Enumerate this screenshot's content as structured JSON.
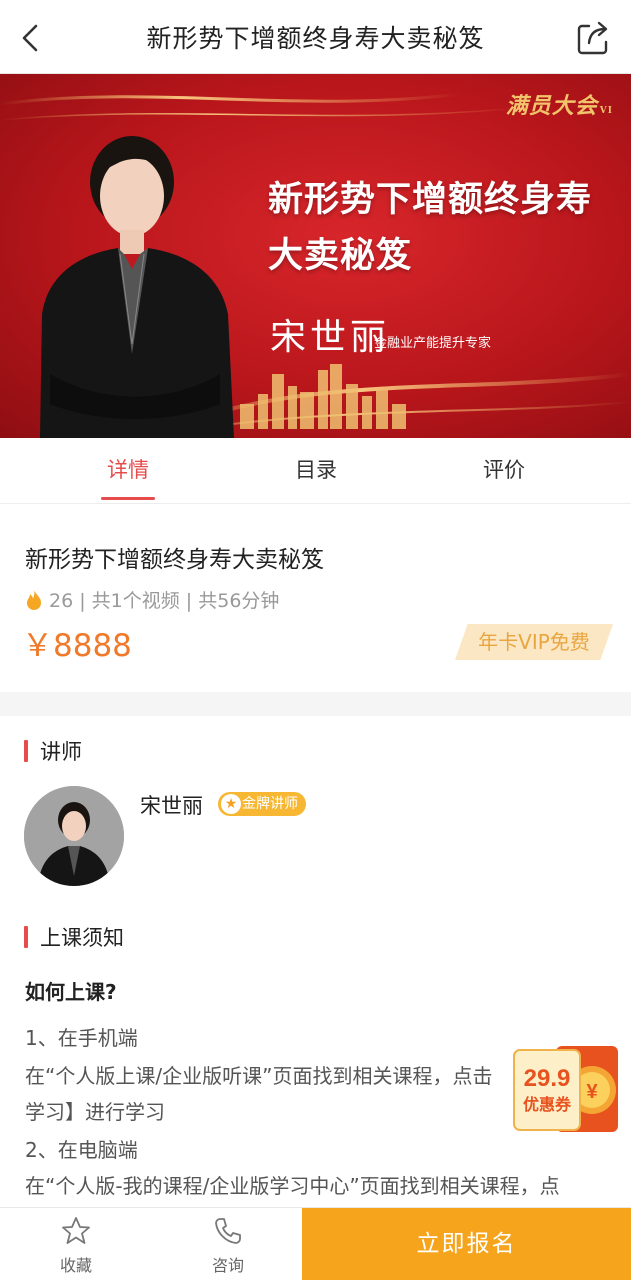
{
  "header": {
    "title": "新形势下增额终身寿大卖秘笈"
  },
  "banner": {
    "logo_text": "满员大会",
    "logo_mark": "VI",
    "title_line1": "新形势下增额终身寿",
    "title_line2": "大卖秘笈",
    "lecturer_name": "宋世丽",
    "lecturer_title": "金融业产能提升专家"
  },
  "tabs": [
    {
      "label": "详情",
      "active": true
    },
    {
      "label": "目录",
      "active": false
    },
    {
      "label": "评价",
      "active": false
    }
  ],
  "course": {
    "title": "新形势下增额终身寿大卖秘笈",
    "meta": "26 | 共1个视频 | 共56分钟",
    "price": "￥8888",
    "vip_label": "年卡VIP免费"
  },
  "lecturer_section": {
    "heading": "讲师",
    "name": "宋世丽",
    "badge": "金牌讲师"
  },
  "notice": {
    "heading": "上课须知",
    "howto": "如何上课?",
    "lines": [
      "1、在手机端",
      "在“个人版上课/企业版听课”页面找到相关课程，点击",
      "学习】进行学习",
      "2、在电脑端",
      "在“个人版-我的课程/企业版学习中心”页面找到相关课程，点"
    ]
  },
  "coupon": {
    "amount": "29.9",
    "label": "优惠券"
  },
  "bottom_bar": {
    "favorite": "收藏",
    "consult": "咨询",
    "enroll": "立即报名"
  },
  "colors": {
    "accent_red": "#e74c4c",
    "price_orange": "#f07a2a",
    "enroll_orange": "#f7a41d",
    "banner_red": "#c41a20"
  }
}
